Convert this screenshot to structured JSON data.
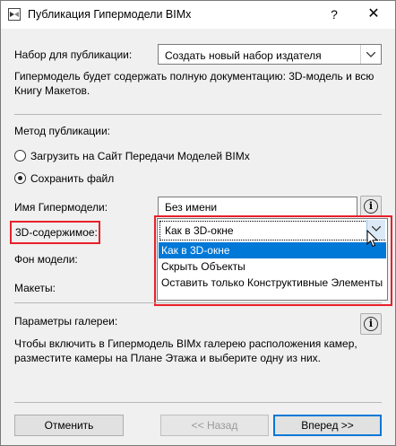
{
  "window": {
    "title": "Публикация Гипермодели BIMx",
    "help_label": "?",
    "close_label": "✕"
  },
  "publish_set": {
    "label": "Набор для публикации:",
    "value": "Создать новый набор издателя",
    "description": "Гипермодель будет содержать полную документацию: 3D-модель и всю Книгу Макетов."
  },
  "method": {
    "label": "Метод публикации:",
    "options": [
      {
        "label": "Загрузить на Сайт Передачи Моделей BIMx",
        "checked": false
      },
      {
        "label": "Сохранить файл",
        "checked": true
      }
    ]
  },
  "hypermodel_name": {
    "label": "Имя Гипермодели:",
    "value": "Без имени"
  },
  "content_3d": {
    "label": "3D-содержимое:",
    "value": "Как в 3D-окне",
    "options": [
      "Как в 3D-окне",
      "Скрыть Объекты",
      "Оставить только Конструктивные Элементы"
    ],
    "selected_index": 0
  },
  "model_background": {
    "label": "Фон модели:"
  },
  "layouts": {
    "label": "Макеты:"
  },
  "gallery": {
    "label": "Параметры галереи:",
    "description": "Чтобы включить в Гипермодель BIMx галерею расположения камер, разместите камеры на Плане Этажа и выберите одну из них."
  },
  "buttons": {
    "cancel": "Отменить",
    "back": "<< Назад",
    "next": "Вперед >>"
  },
  "icons": {
    "app": "bimx-app-icon",
    "info": "info-icon",
    "cursor": "mouse-pointer-icon"
  },
  "colors": {
    "highlight_red": "#e8202a",
    "selection_blue": "#0078d7"
  }
}
